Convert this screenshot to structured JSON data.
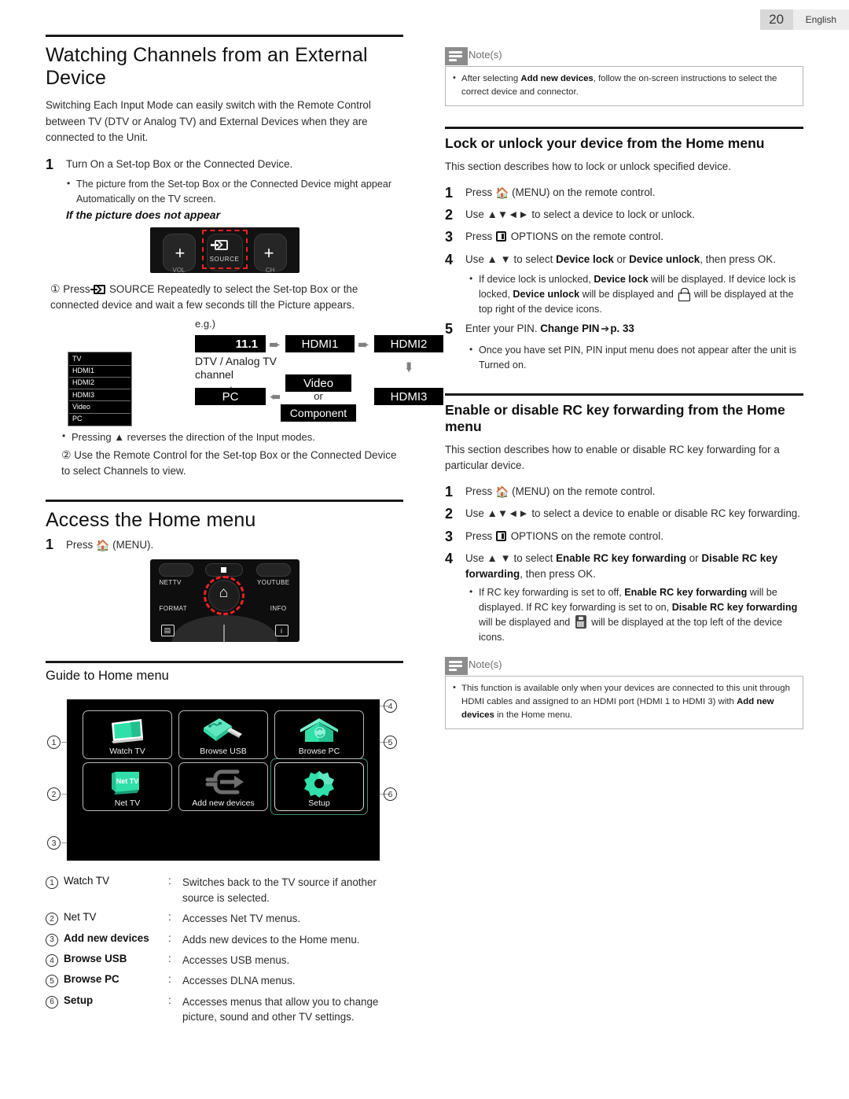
{
  "header": {
    "page_number": "20",
    "language": "English"
  },
  "left": {
    "title": "Watching Channels from an External Device",
    "intro": "Switching Each Input Mode can easily switch with the Remote Control between TV (DTV or Analog TV) and External Devices when they are connected to the Unit.",
    "step1": {
      "num": "1",
      "text": "Turn On a Set-top Box or the Connected Device."
    },
    "bullet1": "The picture from the Set-top Box or the Connected Device might appear Automatically on the TV screen.",
    "subheading_italic": "If the picture does not appear",
    "remote_source": {
      "source_label": "SOURCE",
      "vol_label": "VOL",
      "ch_label": "CH",
      "plus_left": "+",
      "plus_right": "+"
    },
    "circled1_text_a": "Press",
    "circled1_text_b": "SOURCE Repeatedly to select the Set-top Box or the connected device and wait a few seconds till the Picture appears.",
    "eg_label": "e.g.)",
    "input_list": [
      "TV",
      "HDMI1",
      "HDMI2",
      "HDMI3",
      "Video",
      "PC"
    ],
    "diagram": {
      "channel": "11.1",
      "hdmi1": "HDMI1",
      "hdmi2": "HDMI2",
      "hdmi3": "HDMI3",
      "pc": "PC",
      "video": "Video",
      "or": "or",
      "component": "Component",
      "dtv_label_line1": "DTV / Analog TV",
      "dtv_label_line2": "channel"
    },
    "bullet_pressing": "Pressing ▲ reverses the direction of the Input modes.",
    "circled2_text": "Use the Remote Control for the Set-top Box or the Connected Device to select Channels to view.",
    "home_title": "Access the Home menu",
    "home_step1_num": "1",
    "home_step1_text_a": "Press",
    "home_step1_text_b": "(MENU).",
    "remote_home": {
      "nettv": "NETTV",
      "youtube": "YOUTUBE",
      "format": "FORMAT",
      "info": "INFO"
    },
    "guide_title": "Guide to Home menu",
    "home_tiles": [
      {
        "id": "watch-tv",
        "label": "Watch TV",
        "callout": "1"
      },
      {
        "id": "browse-usb",
        "label": "Browse USB",
        "callout": "4"
      },
      {
        "id": "browse-pc",
        "label": "Browse PC",
        "callout": "5"
      },
      {
        "id": "net-tv",
        "label": "Net TV",
        "callout": "2"
      },
      {
        "id": "add-new-devices",
        "label": "Add new devices",
        "callout": "3"
      },
      {
        "id": "setup",
        "label": "Setup",
        "callout": "6"
      }
    ],
    "net_tv_logo": "Net TV",
    "legend": [
      {
        "num": "1",
        "name": "Watch TV",
        "bold": false,
        "colon": ":",
        "desc": "Switches back to the TV source if another source is selected."
      },
      {
        "num": "2",
        "name": "Net TV",
        "bold": false,
        "colon": ":",
        "desc": "Accesses Net TV menus."
      },
      {
        "num": "3",
        "name": "Add new devices",
        "bold": true,
        "colon": ":",
        "desc": "Adds new devices to the Home menu."
      },
      {
        "num": "4",
        "name": "Browse USB",
        "bold": true,
        "colon": ":",
        "desc": "Accesses USB menus."
      },
      {
        "num": "5",
        "name": "Browse PC",
        "bold": true,
        "colon": ":",
        "desc": "Accesses DLNA menus."
      },
      {
        "num": "6",
        "name": "Setup",
        "bold": true,
        "colon": ":",
        "desc": "Accesses menus that allow you to change picture, sound and other TV settings."
      }
    ]
  },
  "right": {
    "note_top": {
      "label": "Note(s)",
      "bullet_a": "After selecting ",
      "bullet_b": "Add new devices",
      "bullet_c": ", follow the on-screen instructions to select the correct device and connector."
    },
    "lock": {
      "title": "Lock or unlock your device from the Home menu",
      "intro": "This section describes how to lock or unlock specified device.",
      "step1_num": "1",
      "step1_a": "Press",
      "step1_b": "(MENU) on the remote control.",
      "step2_num": "2",
      "step2_a": "Use",
      "step2_b": "to select a device to lock or unlock.",
      "step3_num": "3",
      "step3_a": "Press",
      "step3_b": "OPTIONS on the remote control.",
      "step4_num": "4",
      "step4_a": "Use ▲ ▼ to select ",
      "step4_b": "Device lock",
      "step4_c": " or ",
      "step4_d": "Device unlock",
      "step4_e": ", then press OK.",
      "bullet1_a": "If device lock is unlocked, ",
      "bullet1_b": "Device lock",
      "bullet1_c": " will be displayed. If device lock is locked, ",
      "bullet1_d": "Device unlock",
      "bullet1_e": " will be displayed and ",
      "bullet1_f": " will be displayed at the top right of the device icons.",
      "step5_num": "5",
      "step5_a": "Enter your PIN. ",
      "step5_b": "Change PIN",
      "step5_c": "p. 33",
      "bullet2": "Once you have set PIN, PIN input menu does not appear after the unit is Turned on."
    },
    "rc": {
      "title": "Enable or disable RC key forwarding from the Home menu",
      "intro": "This section describes how to enable or disable RC key forwarding for a particular device.",
      "step1_num": "1",
      "step1_a": "Press",
      "step1_b": "(MENU) on the remote control.",
      "step2_num": "2",
      "step2_a": "Use",
      "step2_b": "to select a device to enable or disable RC key forwarding.",
      "step3_num": "3",
      "step3_a": "Press",
      "step3_b": "OPTIONS on the remote control.",
      "step4_num": "4",
      "step4_a": "Use ▲ ▼ to select ",
      "step4_b": "Enable RC key forwarding",
      "step4_c": " or ",
      "step4_d": "Disable RC key forwarding",
      "step4_e": ", then press OK.",
      "bullet1_a": "If RC key forwarding is set to off, ",
      "bullet1_b": "Enable RC key forwarding",
      "bullet1_c": " will be displayed. If RC key forwarding is set to on, ",
      "bullet1_d": "Disable RC key forwarding",
      "bullet1_e": " will be displayed and ",
      "bullet1_f": " will be displayed at the top left of the device icons."
    },
    "note_bottom": {
      "label": "Note(s)",
      "bullet_a": "This function is available only when your devices are connected to this unit through HDMI cables and assigned to an HDMI port (HDMI 1 to HDMI 3) with ",
      "bullet_b": "Add new devices",
      "bullet_c": " in the Home menu."
    }
  },
  "colors": {
    "accent_green": "#2FE0A8",
    "highlight_red": "#EE2222",
    "note_gray": "#8C8C8C"
  }
}
